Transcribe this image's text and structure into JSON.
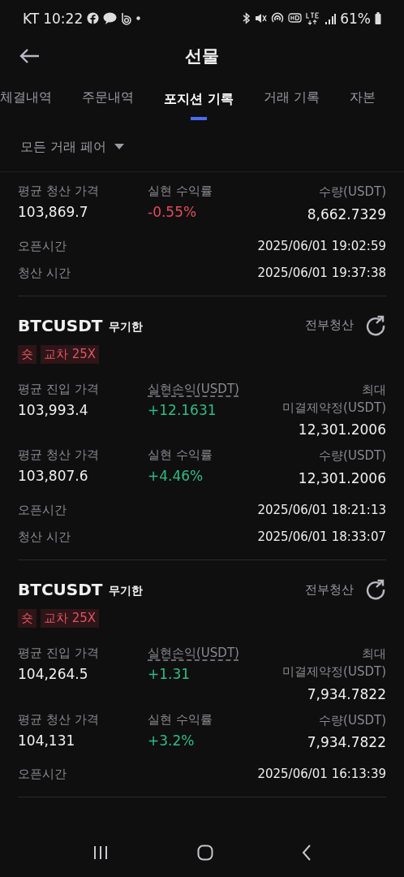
{
  "status_bar": {
    "carrier": "KT",
    "time": "10:22",
    "battery": "61%"
  },
  "header": {
    "title": "선물"
  },
  "tabs": [
    {
      "label": "체결내역",
      "selected": false
    },
    {
      "label": "주문내역",
      "selected": false
    },
    {
      "label": "포지션 기록",
      "selected": true
    },
    {
      "label": "거래 기록",
      "selected": false
    },
    {
      "label": "자본",
      "selected": false
    }
  ],
  "filter": {
    "label": "모든 거래 페어"
  },
  "positions": [
    {
      "rows": [
        [
          {
            "label": "평균 청산 가격",
            "value": "103,869.7"
          },
          {
            "label": "실현 수익률",
            "value": "-0.55%",
            "color": "#e04c5a"
          },
          {
            "label": "수량(USDT)",
            "value": "8,662.7329"
          }
        ]
      ],
      "times": [
        {
          "label": "오픈시간",
          "value": "2025/06/01 19:02:59"
        },
        {
          "label": "청산 시간",
          "value": "2025/06/01 19:37:38"
        }
      ]
    },
    {
      "symbol": "BTCUSDT",
      "type": "무기한",
      "close_all": "전부청산",
      "tags": [
        "숏",
        "교차 25X"
      ],
      "rows": [
        [
          {
            "label": "평균 진입 가격",
            "value": "103,993.4"
          },
          {
            "label": "실현손익(USDT)",
            "value": "+12.1631",
            "color": "#2ebd85",
            "underlined": true
          },
          {
            "label": "최대\n미결제약정(USDT)",
            "value": "12,301.2006"
          }
        ],
        [
          {
            "label": "평균 청산 가격",
            "value": "103,807.6"
          },
          {
            "label": "실현 수익률",
            "value": "+4.46%",
            "color": "#2ebd85"
          },
          {
            "label": "수량(USDT)",
            "value": "12,301.2006"
          }
        ]
      ],
      "times": [
        {
          "label": "오픈시간",
          "value": "2025/06/01 18:21:13"
        },
        {
          "label": "청산 시간",
          "value": "2025/06/01 18:33:07"
        }
      ]
    },
    {
      "symbol": "BTCUSDT",
      "type": "무기한",
      "close_all": "전부청산",
      "tags": [
        "숏",
        "교차 25X"
      ],
      "rows": [
        [
          {
            "label": "평균 진입 가격",
            "value": "104,264.5"
          },
          {
            "label": "실현손익(USDT)",
            "value": "+1.31",
            "color": "#2ebd85",
            "underlined": true
          },
          {
            "label": "최대\n미결제약정(USDT)",
            "value": "7,934.7822"
          }
        ],
        [
          {
            "label": "평균 청산 가격",
            "value": "104,131"
          },
          {
            "label": "실현 수익률",
            "value": "+3.2%",
            "color": "#2ebd85"
          },
          {
            "label": "수량(USDT)",
            "value": "7,934.7822"
          }
        ]
      ],
      "times": [
        {
          "label": "오픈시간",
          "value": "2025/06/01 16:13:39"
        }
      ]
    }
  ]
}
